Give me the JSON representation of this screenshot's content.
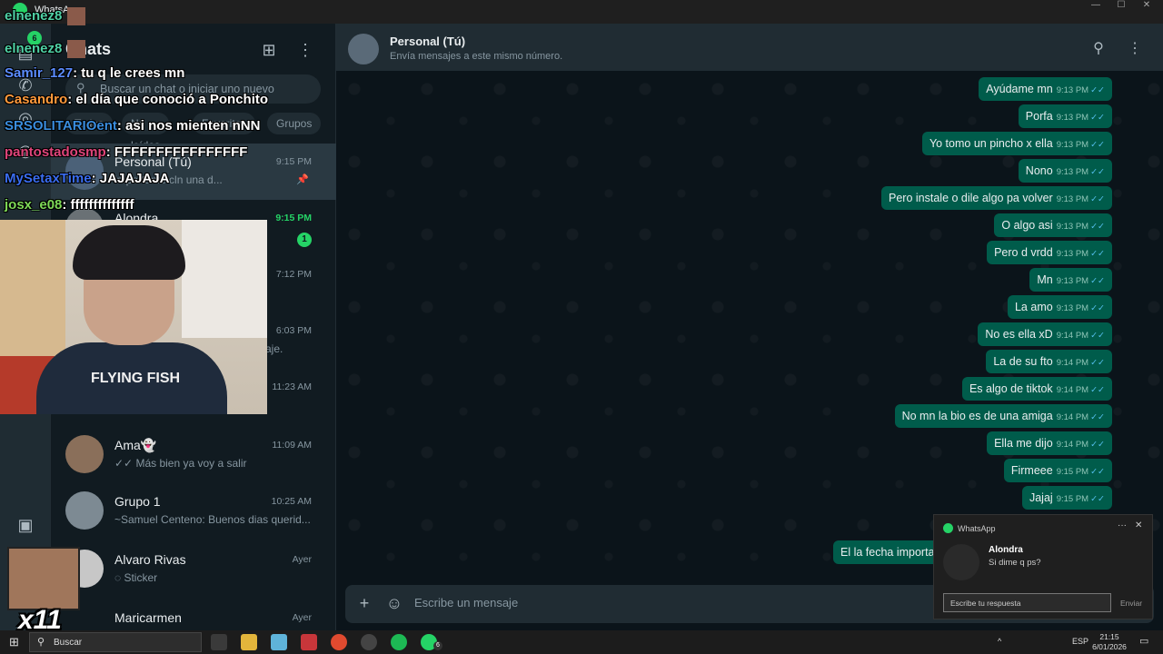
{
  "window": {
    "app_name": "WhatsApp"
  },
  "chat_list": {
    "title": "Chats",
    "search_placeholder": "Buscar un chat o iniciar uno nuevo",
    "filters": [
      "Todos",
      "No leídos",
      "Favoritos",
      "Grupos"
    ],
    "chats": [
      {
        "name": "Personal (Tú)",
        "preview": "importante cln una d...",
        "time": "9:15 PM",
        "pinned": true,
        "active": true
      },
      {
        "name": "Alondra",
        "preview": "",
        "time": "9:15 PM",
        "unread": "1"
      },
      {
        "name": "",
        "preview": "",
        "time": "7:12 PM"
      },
      {
        "name": "",
        "preview": "aje.",
        "time": "6:03 PM"
      },
      {
        "name": "",
        "preview": "",
        "time": "11:23 AM"
      },
      {
        "name": "Ama👻",
        "preview": "✓✓ Más bien ya voy a salir",
        "time": "11:09 AM"
      },
      {
        "name": "Grupo 1",
        "preview": "~Samuel Centeno: Buenos dias querid...",
        "time": "10:25 AM"
      },
      {
        "name": "Alvaro Rivas",
        "preview": "Sticker",
        "time": "Ayer"
      },
      {
        "name": "Maricarmen",
        "preview": "",
        "time": "Ayer"
      }
    ]
  },
  "conversation": {
    "name": "Personal (Tú)",
    "subtitle": "Envía mensajes a este mismo número.",
    "messages": [
      {
        "text": "Ayúdame mn",
        "time": "9:13 PM"
      },
      {
        "text": "Porfa",
        "time": "9:13 PM"
      },
      {
        "text": "Yo tomo un pincho x ella",
        "time": "9:13 PM"
      },
      {
        "text": "Nono",
        "time": "9:13 PM"
      },
      {
        "text": "Pero instale o dile algo pa volver",
        "time": "9:13 PM"
      },
      {
        "text": "O algo asi",
        "time": "9:13 PM"
      },
      {
        "text": "Pero d vrdd",
        "time": "9:13 PM"
      },
      {
        "text": "Mn",
        "time": "9:13 PM"
      },
      {
        "text": "La amo",
        "time": "9:13 PM"
      },
      {
        "text": "No es ella xD",
        "time": "9:14 PM"
      },
      {
        "text": "La de su fto",
        "time": "9:14 PM"
      },
      {
        "text": "Es algo de tiktok",
        "time": "9:14 PM"
      },
      {
        "text": "No mn la bio es de una amiga",
        "time": "9:14 PM"
      },
      {
        "text": "Ella me dijo",
        "time": "9:14 PM"
      },
      {
        "text": "Firmeee",
        "time": "9:15 PM"
      },
      {
        "text": "Jajaj",
        "time": "9:15 PM"
      },
      {
        "text": "El la fecha importar",
        "time": ""
      }
    ],
    "composer_placeholder": "Escribe un mensaje"
  },
  "notification": {
    "app": "WhatsApp",
    "sender": "Alondra",
    "message": "Si dime q ps?",
    "reply_placeholder": "Escribe tu respuesta",
    "send_label": "Enviar"
  },
  "stream_chat": [
    {
      "user": "elnenez8",
      "msg": "",
      "color": "#4fd1a5"
    },
    {
      "user": "elnenez8",
      "msg": "",
      "color": "#4fd1a5"
    },
    {
      "user": "Samir_127",
      "msg": ": tu q le crees mn",
      "color": "#5b8cff"
    },
    {
      "user": "Casandro",
      "msg": ": el día que conoció a Ponchito",
      "color": "#ff9a3c"
    },
    {
      "user": "SRSOLITARIOent",
      "msg": ": asi nos mienten nNN",
      "color": "#3a8dde"
    },
    {
      "user": "pantostadosmp",
      "msg": ": FFFFFFFFFFFFFFFF",
      "color": "#e0457b"
    },
    {
      "user": "MySetaxTime",
      "msg": ": JAJAJAJA",
      "color": "#3a6df0"
    },
    {
      "user": "josx_e08",
      "msg": ": ffffffffffffff",
      "color": "#7ed957"
    }
  ],
  "webcam": {
    "shirt_text": "FLYING FISH"
  },
  "emote_count": "x11",
  "taskbar": {
    "search_label": "Buscar",
    "language": "ESP",
    "time": "21:15",
    "date": "6/01/2026",
    "whatsapp_badge": "6"
  },
  "rail_badge": "6",
  "colors": {
    "accent": "#25d366",
    "outgoing_bubble": "#005c4b",
    "panel": "#111b21"
  }
}
